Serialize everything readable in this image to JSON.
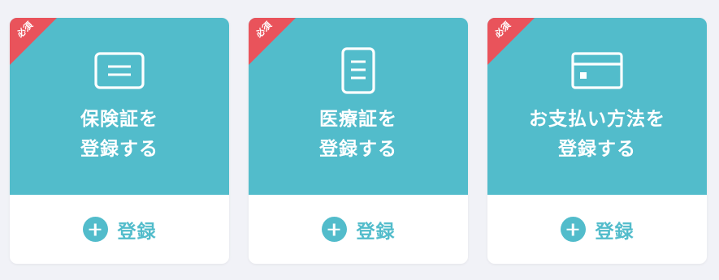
{
  "colors": {
    "card_accent": "#52bccb",
    "required_ribbon": "#e9535b",
    "background": "#f1f2f7",
    "card_bottom": "#ffffff"
  },
  "cards": [
    {
      "required_label": "必須",
      "icon": "insurance-card-icon",
      "title_line1": "保険証を",
      "title_line2": "登録する",
      "register_label": "登録"
    },
    {
      "required_label": "必須",
      "icon": "medical-certificate-icon",
      "title_line1": "医療証を",
      "title_line2": "登録する",
      "register_label": "登録"
    },
    {
      "required_label": "必須",
      "icon": "credit-card-icon",
      "title_line1": "お支払い方法を",
      "title_line2": "登録する",
      "register_label": "登録"
    }
  ]
}
